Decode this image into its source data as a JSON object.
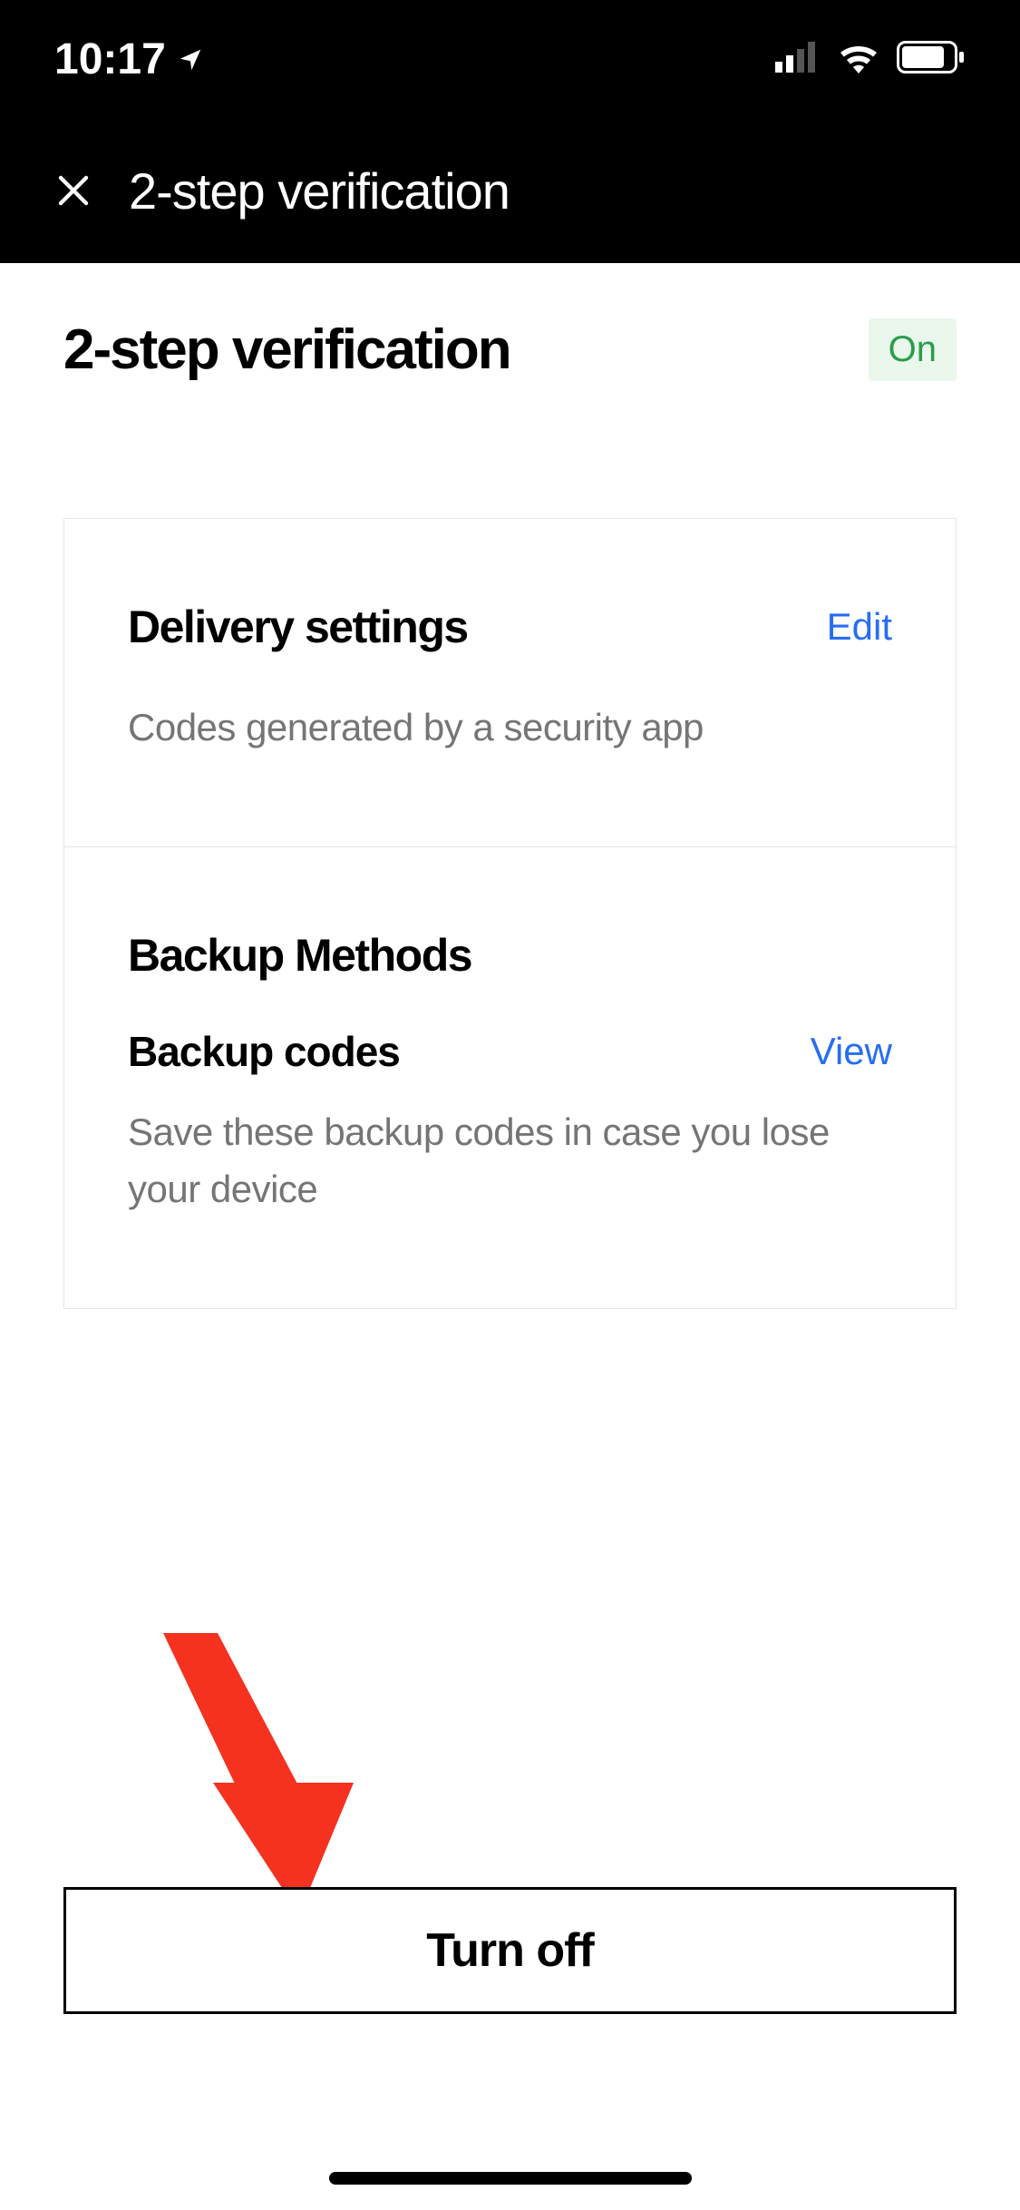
{
  "status": {
    "time": "10:17"
  },
  "header": {
    "title": "2-step verification"
  },
  "page": {
    "title": "2-step verification",
    "badge": "On"
  },
  "delivery": {
    "title": "Delivery settings",
    "action": "Edit",
    "desc": "Codes generated by a security app"
  },
  "backup": {
    "title": "Backup Methods",
    "sub_title": "Backup codes",
    "action": "View",
    "desc": "Save these backup codes in case you lose your device"
  },
  "button": {
    "turn_off": "Turn off"
  }
}
